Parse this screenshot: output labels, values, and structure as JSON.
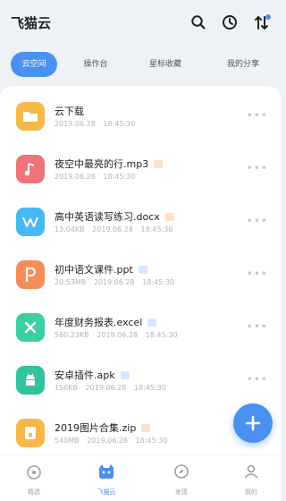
{
  "app": {
    "title": "飞猫云"
  },
  "header_icons": [
    "search-icon",
    "history-icon",
    "sort-icon"
  ],
  "tabs": [
    {
      "label": "云空间",
      "active": true
    },
    {
      "label": "操作台",
      "active": false
    },
    {
      "label": "星标收藏",
      "active": false
    },
    {
      "label": "我的分享",
      "active": false
    }
  ],
  "files": [
    {
      "name": "云下载",
      "meta": "2019.06.28 18:45:30",
      "icon": "folder-icon",
      "color": "#f7b84b",
      "badge": ""
    },
    {
      "name": "夜空中最亮的行.mp3",
      "meta": "2019.06.28 18:45:30",
      "icon": "music-icon",
      "color": "#f0737a",
      "badge": "orange"
    },
    {
      "name": "高中英语读写练习.docx",
      "meta": "13.04KB 2019.06.28 18:45:30",
      "icon": "word-icon",
      "color": "#46b9f4",
      "badge": "orange"
    },
    {
      "name": "初中语文课件.ppt",
      "meta": "20.53MB 2019.06.28 18:45:30",
      "icon": "ppt-icon",
      "color": "#f58d5a",
      "badge": "blue"
    },
    {
      "name": "年度财务报表.excel",
      "meta": "560.23KB 2019.06.28 18:45:30",
      "icon": "excel-icon",
      "color": "#3bd0a2",
      "badge": "blue"
    },
    {
      "name": "安卓插件.apk",
      "meta": "156KB 2019.06.28 18:45:30",
      "icon": "android-icon",
      "color": "#33c2a0",
      "badge": "blue"
    },
    {
      "name": "2019图片合集.zip",
      "meta": "540MB 2019.06.28 18:45:30",
      "icon": "zip-icon",
      "color": "#f7b84b",
      "badge": "orange"
    }
  ],
  "bottom_nav": [
    {
      "label": "精选",
      "active": false
    },
    {
      "label": "飞猫云",
      "active": true
    },
    {
      "label": "发现",
      "active": false
    },
    {
      "label": "我的",
      "active": false
    }
  ],
  "colors": {
    "accent": "#4a90f0",
    "background": "#eef1f5"
  }
}
